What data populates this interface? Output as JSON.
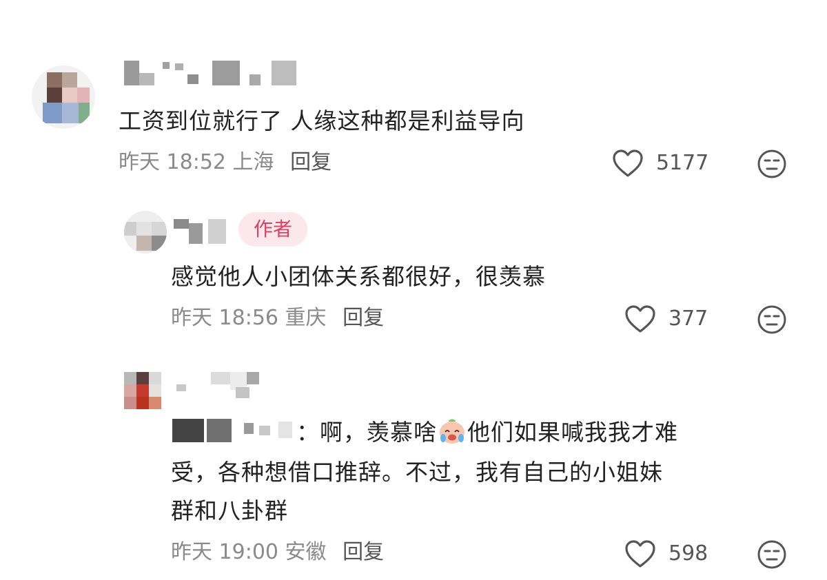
{
  "comments": [
    {
      "text": "工资到位就行了 人缘这种都是利益导向",
      "time": "昨天 18:52",
      "location": "上海",
      "reply_label": "回复",
      "likes": "5177"
    },
    {
      "badge": "作者",
      "text": "感觉他人小团体关系都很好，很羡慕",
      "time": "昨天 18:56",
      "location": "重庆",
      "reply_label": "回复",
      "likes": "377"
    },
    {
      "text_prefix": "：啊，羡慕啥",
      "text_suffix": "他们如果喊我我才难",
      "text_line2": "受，各种想借口推辞。不过，我有自己的小姐妹",
      "text_line3": "群和八卦群",
      "time": "昨天 19:00",
      "location": "安徽",
      "reply_label": "回复",
      "likes": "598"
    }
  ],
  "icons": {
    "like": "heart-outline-icon",
    "dislike": "unhappy-face-icon",
    "emoji": "crying-face-emoji"
  },
  "colors": {
    "badge_bg": "#fbe8ec",
    "badge_text": "#e0405e",
    "meta": "#8a8a8a"
  }
}
